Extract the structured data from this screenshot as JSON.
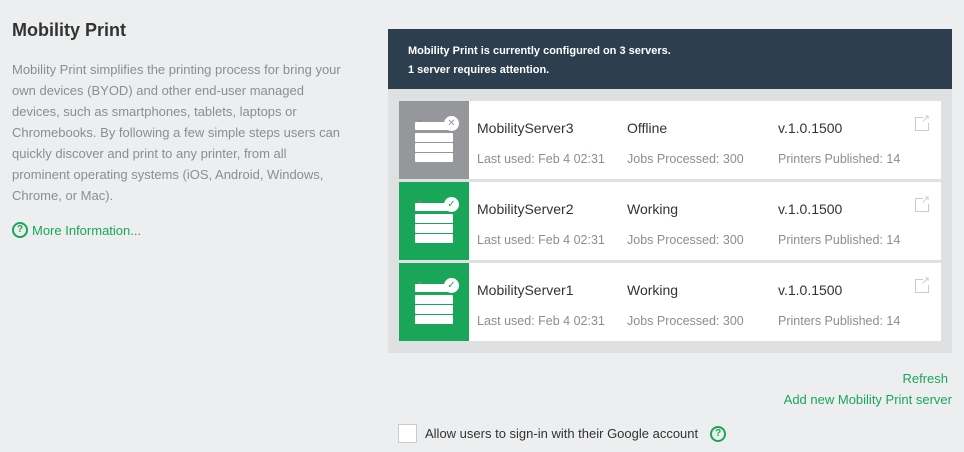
{
  "left": {
    "title": "Mobility Print",
    "description": "Mobility Print simplifies the printing process for bring your own devices (BYOD) and other end-user managed devices, such as smartphones, tablets, laptops or Chromebooks. By following a few simple steps users can quickly discover and print to any printer, from all prominent operating systems (iOS, Android, Windows, Chrome, or Mac).",
    "more_info": "More Information..."
  },
  "banner": {
    "line1": "Mobility Print is currently configured on 3 servers.",
    "line2": "1 server requires attention."
  },
  "servers": [
    {
      "name": "MobilityServer3",
      "status": "Offline",
      "version": "v.1.0.1500",
      "last_used": "Last used:  Feb 4 02:31",
      "jobs": "Jobs Processed:  300",
      "printers": "Printers Published:  14",
      "state": "offline"
    },
    {
      "name": "MobilityServer2",
      "status": "Working",
      "version": "v.1.0.1500",
      "last_used": "Last used:  Feb 4 02:31",
      "jobs": "Jobs Processed:  300",
      "printers": "Printers Published:  14",
      "state": "online"
    },
    {
      "name": "MobilityServer1",
      "status": "Working",
      "version": "v.1.0.1500",
      "last_used": "Last used:  Feb 4 02:31",
      "jobs": "Jobs Processed:  300",
      "printers": "Printers Published:  14",
      "state": "online"
    }
  ],
  "actions": {
    "refresh": "Refresh",
    "add_new": "Add new Mobility Print server"
  },
  "google": {
    "label": "Allow users to sign-in with their Google account",
    "checked": false
  },
  "colors": {
    "accent": "#1aa658",
    "banner": "#2d3e4f",
    "offline": "#95979b"
  }
}
